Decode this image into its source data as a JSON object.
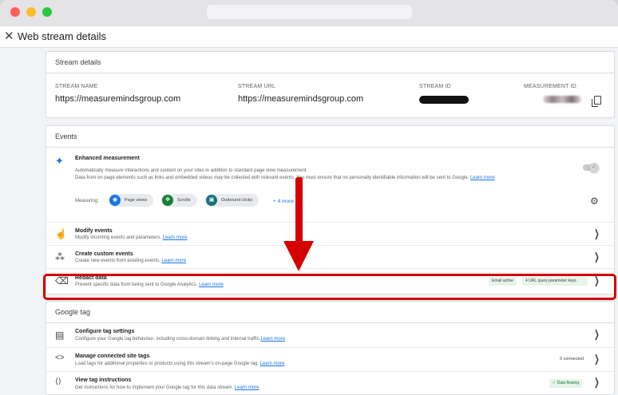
{
  "header": {
    "close_icon": "close-icon",
    "title": "Web stream details"
  },
  "stream_details": {
    "heading": "Stream details",
    "stream_name_label": "STREAM NAME",
    "stream_name": "https://measuremindsgroup.com",
    "stream_url_label": "STREAM URL",
    "stream_url": "https://measuremindsgroup.com",
    "stream_id_label": "STREAM ID",
    "measurement_id_label": "MEASUREMENT ID"
  },
  "events": {
    "heading": "Events",
    "enhanced": {
      "title": "Enhanced measurement",
      "desc1": "Automatically measure interactions and content on your sites in addition to standard page view measurement.",
      "desc2": "Data from on page elements such as links and embedded videos may be collected with relevant events. You must ensure that no personally identifiable information will be sent to Google.",
      "learn_more": "Learn more",
      "measuring_label": "Measuring:",
      "chips": [
        "Page views",
        "Scrolls",
        "Outbound clicks"
      ],
      "more": "+ 4 more"
    },
    "modify": {
      "title": "Modify events",
      "desc": "Modify incoming events and parameters.",
      "learn_more": "Learn more"
    },
    "create": {
      "title": "Create custom events",
      "desc": "Create new events from existing events.",
      "learn_more": "Learn more"
    },
    "redact": {
      "title": "Redact data",
      "desc": "Prevent specific data from being sent to Google Analytics.",
      "learn_more": "Learn more",
      "badges": [
        "Email active",
        "4 URL query parameter keys"
      ]
    }
  },
  "google_tag": {
    "heading": "Google tag",
    "configure": {
      "title": "Configure tag settings",
      "desc": "Configure your Google tag behaviour, including cross-domain linking and internal traffic.",
      "learn_more": "Learn more"
    },
    "manage": {
      "title": "Manage connected site tags",
      "desc": "Load tags for additional properties or products using this stream's on-page Google tag.",
      "learn_more": "Learn more",
      "status": "0 connected"
    },
    "view": {
      "title": "View tag instructions",
      "desc": "Get instructions for how to implement your Google tag for this data stream.",
      "learn_more": "Learn more",
      "status": "✓ Data flowing"
    }
  },
  "colors": {
    "annotation_red": "#d50000",
    "link": "#1a73e8",
    "chip_page_views": "#1a73e8",
    "chip_scrolls": "#188038",
    "chip_outbound": "#12737b"
  }
}
